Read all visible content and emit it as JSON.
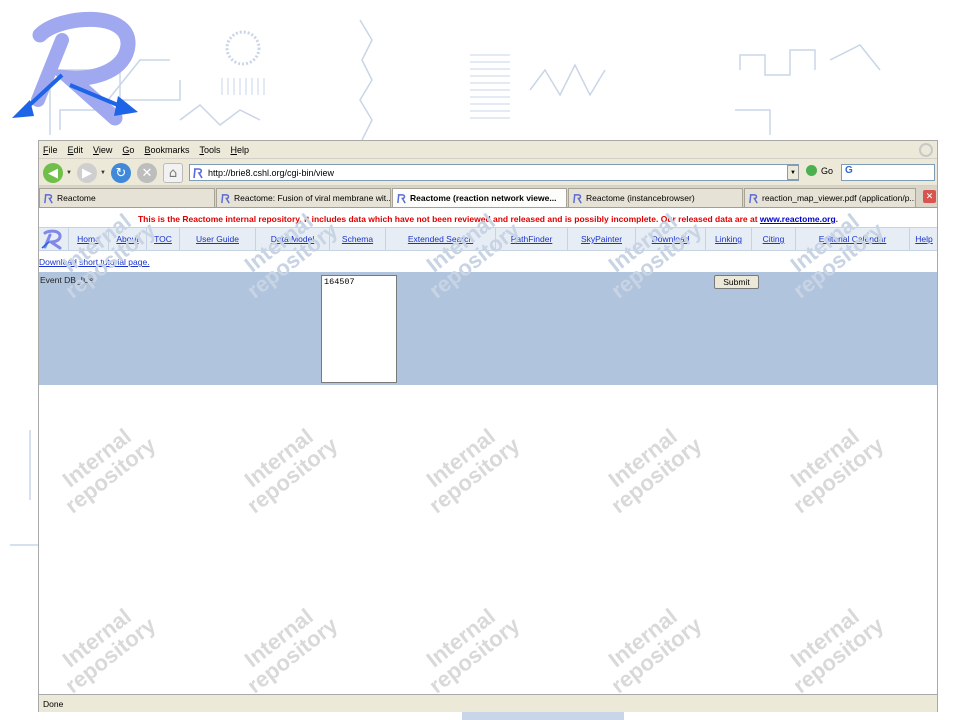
{
  "menubar": {
    "items": [
      "File",
      "Edit",
      "View",
      "Go",
      "Bookmarks",
      "Tools",
      "Help"
    ]
  },
  "navbar": {
    "url": "http://brie8.cshl.org/cgi-bin/view",
    "go_label": "Go",
    "search_value": "G"
  },
  "tabs": [
    {
      "label": "Reactome",
      "active": false
    },
    {
      "label": "Reactome: Fusion of viral membrane wit...",
      "active": false
    },
    {
      "label": "Reactome (reaction network viewe...",
      "active": true
    },
    {
      "label": "Reactome (instancebrowser)",
      "active": false
    },
    {
      "label": "reaction_map_viewer.pdf (application/p...",
      "active": false
    }
  ],
  "page": {
    "notice_text": "This is the Reactome internal repository. It includes data which have not been reviewed and released and is possibly incomplete. Our released data are at ",
    "notice_link": "www.reactome.org",
    "notice_end": ".",
    "nav_items": [
      "Home",
      "About",
      "TOC",
      "User Guide",
      "Data Model",
      "Schema",
      "Extended Search",
      "PathFinder",
      "SkyPainter",
      "Download",
      "Linking",
      "Citing",
      "Editorial Calendar",
      "Help"
    ],
    "tutorial_link": "Download short tutorial page.",
    "form": {
      "label": "Event DB_IDs",
      "textarea_value": "164507",
      "submit_label": "Submit"
    }
  },
  "statusbar": {
    "text": "Done"
  },
  "watermark": {
    "line1": "Internal",
    "line2": "repository"
  },
  "colors": {
    "accent_red": "#e00000",
    "link_blue": "#1a33cc",
    "panel_blue": "#b0c4de",
    "logo_purple": "#a0a8f0",
    "logo_blue": "#1e64e6"
  },
  "icons": [
    "reactome-logo",
    "back-arrow-icon",
    "forward-arrow-icon",
    "reload-icon",
    "stop-icon",
    "home-icon",
    "go-icon",
    "google-search-icon",
    "close-tab-icon",
    "throbber-icon"
  ]
}
